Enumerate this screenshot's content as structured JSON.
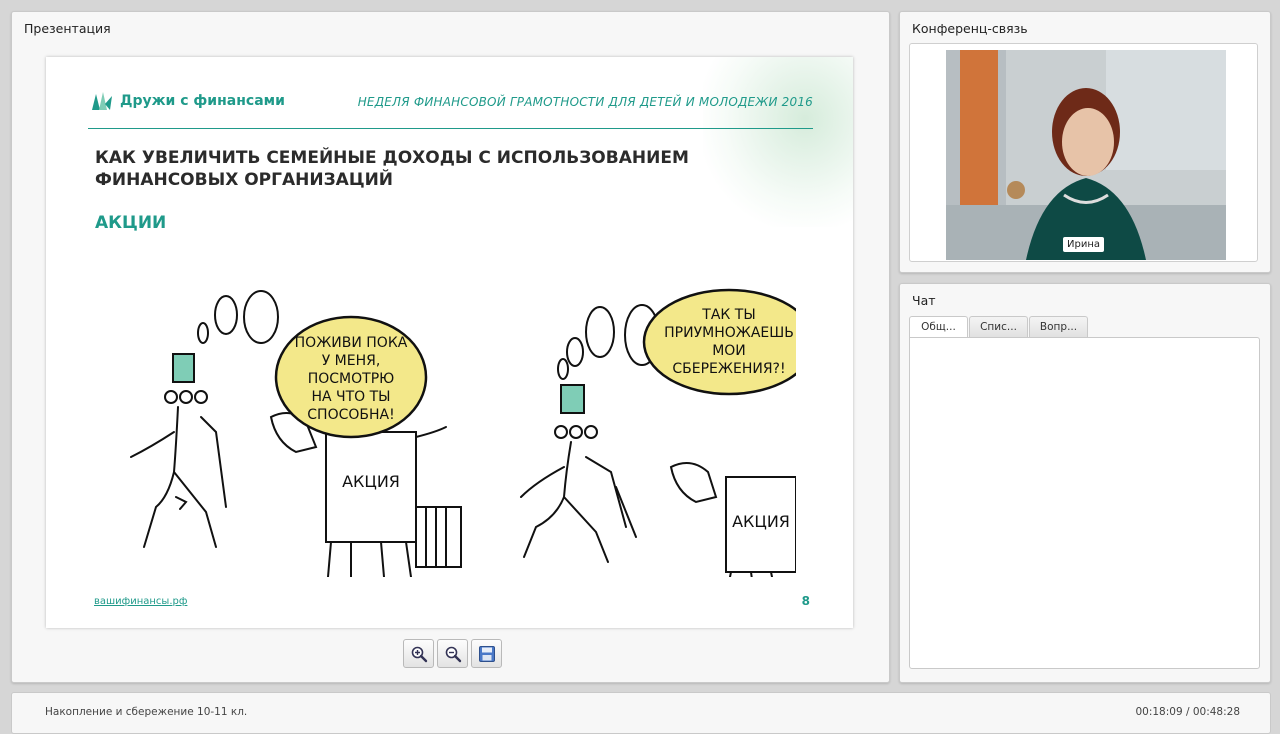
{
  "presentation": {
    "title": "Презентация",
    "slide": {
      "logo_text": "Дружи с финансами",
      "week_text": "НЕДЕЛЯ ФИНАНСОВОЙ ГРАМОТНОСТИ ДЛЯ ДЕТЕЙ И МОЛОДЕЖИ 2016",
      "title_line1": "КАК УВЕЛИЧИТЬ СЕМЕЙНЫЕ ДОХОДЫ С ИСПОЛЬЗОВАНИЕМ",
      "title_line2": "ФИНАНСОВЫХ ОРГАНИЗАЦИЙ",
      "subtitle": "АКЦИИ",
      "bubble1": [
        "ПОЖИВИ ПОКА",
        "У МЕНЯ,",
        "ПОСМОТРЮ",
        "НА ЧТО ТЫ",
        "СПОСОБНА!"
      ],
      "bubble2": [
        "ТАК ТЫ",
        "ПРИУМНОЖАЕШЬ",
        "МОИ",
        "СБЕРЕЖЕНИЯ?!"
      ],
      "box_label": "АКЦИЯ",
      "link": "вашифинансы.рф",
      "page_number": "8"
    },
    "toolbar": {
      "zoom_in_icon": "zoom-in-icon",
      "zoom_out_icon": "zoom-out-icon",
      "save_icon": "save-icon"
    }
  },
  "video": {
    "title": "Конференц-связь",
    "participant": "Ирина"
  },
  "chat": {
    "title": "Чат",
    "tabs": [
      {
        "label": "Общ..."
      },
      {
        "label": "Спис..."
      },
      {
        "label": "Вопр..."
      }
    ]
  },
  "footer": {
    "lesson": "Накопление и сбережение 10-11 кл.",
    "time": "00:18:09 / 00:48:28"
  },
  "colors": {
    "accent": "#1f9a8a",
    "bubble": "#f3e88a",
    "hat": "#7fcdb6"
  }
}
